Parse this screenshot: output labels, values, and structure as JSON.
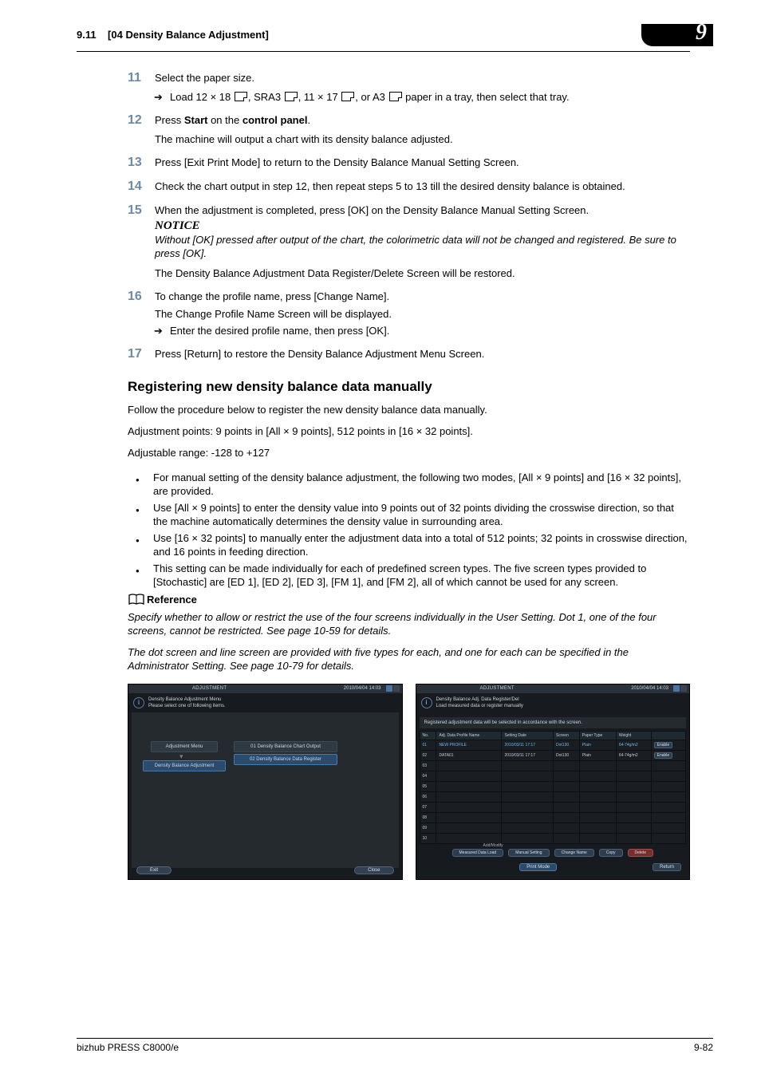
{
  "header": {
    "section_no": "9.11",
    "section_title": "[04 Density Balance Adjustment]",
    "chapter_badge": "9"
  },
  "steps": {
    "s11": {
      "num": "11",
      "text": "Select the paper size."
    },
    "s11_sub": "Load 12 × 18 ",
    "s11_sub_mid1": ", SRA3 ",
    "s11_sub_mid2": ", 11 × 17 ",
    "s11_sub_mid3": ", or A3 ",
    "s11_sub_end": " paper in a tray, then select that tray.",
    "s12": {
      "num": "12",
      "text_pre": "Press ",
      "b1": "Start",
      "text_mid": " on the ",
      "b2": "control panel",
      "text_post": "."
    },
    "s12_sub": "The machine will output a chart with its density balance adjusted.",
    "s13": {
      "num": "13",
      "text": "Press [Exit Print Mode] to return to the Density Balance Manual Setting Screen."
    },
    "s14": {
      "num": "14",
      "text": "Check the chart output in step 12, then repeat steps 5 to 13 till the desired density balance is obtained."
    },
    "s15": {
      "num": "15",
      "text": "When the adjustment is completed, press [OK] on the Density Balance Manual Setting Screen."
    },
    "notice": "NOTICE",
    "notice_body": "Without [OK] pressed after output of the chart, the colorimetric data will not be changed and registered. Be sure to press [OK].",
    "s15_sub2": "The Density Balance Adjustment Data Register/Delete Screen will be restored.",
    "s16": {
      "num": "16",
      "text": "To change the profile name, press [Change Name]."
    },
    "s16_sub1": "The Change Profile Name Screen will be displayed.",
    "s16_sub2": "Enter the desired profile name, then press [OK].",
    "s17": {
      "num": "17",
      "text": "Press [Return] to restore the Density Balance Adjustment Menu Screen."
    }
  },
  "section2": {
    "heading": "Registering new density balance data manually",
    "p1": "Follow the procedure below to register the new density balance data manually.",
    "p2": "Adjustment points: 9 points in [All × 9 points], 512 points in [16 × 32 points].",
    "p3": "Adjustable range: -128 to +127",
    "bullets": [
      "For manual setting of the density balance adjustment, the following two modes, [All × 9 points] and [16 × 32 points], are provided.",
      "Use [All × 9 points] to enter the density value into 9 points out of 32 points dividing the crosswise direction, so that the machine automatically determines the density value in surrounding area.",
      "Use [16 × 32 points] to manually enter the adjustment data into a total of 512 points; 32 points in crosswise direction, and 16 points in feeding direction.",
      "This setting can be made individually for each of predefined screen types. The five screen types provided to [Stochastic] are [ED 1], [ED 2], [ED 3], [FM 1], and [FM 2], all of which cannot be used for any screen."
    ],
    "ref_label": "Reference",
    "ref1": "Specify whether to allow or restrict the use of the four screens individually in the User Setting. Dot 1, one of the four screens, cannot be restricted. See page 10-59 for details.",
    "ref2": "The dot screen and line screen are provided with five types for each, and one for each can be specified in the Administrator Setting. See page 10-79 for details."
  },
  "screenshot1": {
    "titlebar": "ADJUSTMENT",
    "date": "2010/04/04 14:03",
    "info_line1": "Density Balance Adjustment Menu",
    "info_line2": "Please select one of following items.",
    "crumb1": "Adjustment Menu",
    "crumb2": "Density Balance Adjustment",
    "opt1": "01 Density Balance Chart Output",
    "opt2": "02 Density Balance Data Register",
    "btn_exit": "Exit",
    "btn_close": "Close"
  },
  "screenshot2": {
    "titlebar": "ADJUSTMENT",
    "date": "2010/04/04 14:03",
    "info_line1": "Density Balance Adj. Data Register/Del",
    "info_line2": "Load measured data or register manually",
    "note": "Registered adjustment data will be selected in accordance with the screen.",
    "headers": [
      "No.",
      "Adj. Data Profile Name",
      "Setting Date",
      "Screen",
      "Paper Type",
      "Weight",
      ""
    ],
    "rows": [
      {
        "no": "01",
        "name": "NEW PROFILE",
        "date": "2010/03/11 17:17",
        "screen": "Dot130",
        "paper": "Plain",
        "weight": "64-74g/m2",
        "btn": "Enable"
      },
      {
        "no": "02",
        "name": "DATA01",
        "date": "2010/03/11 17:17",
        "screen": "Dot130",
        "paper": "Plain",
        "weight": "64-74g/m2",
        "btn": "Enable"
      },
      {
        "no": "03"
      },
      {
        "no": "04"
      },
      {
        "no": "05"
      },
      {
        "no": "06"
      },
      {
        "no": "07"
      },
      {
        "no": "08"
      },
      {
        "no": "09"
      },
      {
        "no": "10"
      }
    ],
    "addmodify": "Add/Modify",
    "btn_measured": "Measured Data Load",
    "btn_manual": "Manual Setting",
    "btn_change": "Change Name",
    "btn_copy": "Copy",
    "btn_delete": "Delete",
    "btn_print": "Print Mode",
    "btn_return": "Return"
  },
  "footer": {
    "left": "bizhub PRESS C8000/e",
    "right": "9-82"
  }
}
